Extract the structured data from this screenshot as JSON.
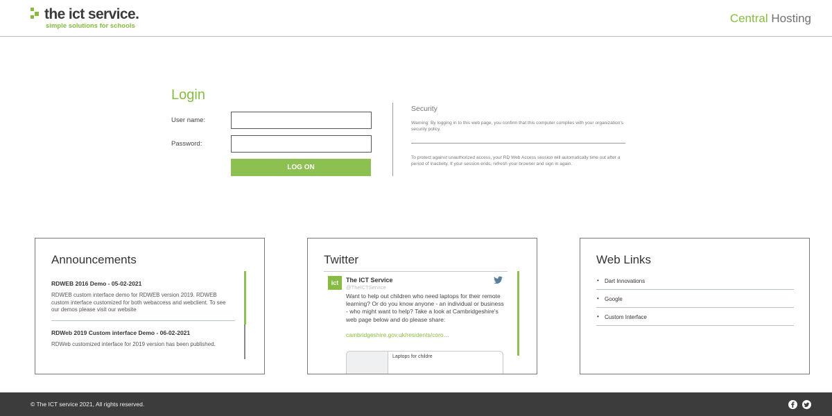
{
  "header": {
    "logo_text": "the ict service.",
    "logo_tagline": "simple solutions for schools",
    "brand_green": "Central",
    "brand_gray": "Hosting"
  },
  "login": {
    "title": "Login",
    "username_label": "User name:",
    "username_value": "",
    "password_label": "Password:",
    "password_value": "",
    "logon_button": "LOG ON"
  },
  "security": {
    "title": "Security",
    "warning": "Warning: By logging in to this web page, you confirm that this computer complies with your organization's security policy.",
    "timeout_note": "To protect against unauthorized access, your RD Web Access session will automatically time out after a period of inactivity. If your session ends, refresh your browser and sign in again."
  },
  "announcements": {
    "title": "Announcements",
    "items": [
      {
        "heading": "RDWEB 2016 Demo - 05-02-2021",
        "body": "RDWEB custom interface demo for RDWEB version 2019. RDWEB custom interface customized for both webaccess and webclient. To see our demos please visit our website"
      },
      {
        "heading": "RDWeb 2019 Custom interface Demo - 06-02-2021",
        "body": "RDWeb customized interface for 2019 version has been published."
      }
    ]
  },
  "twitter": {
    "title": "Twitter",
    "avatar_text": "ict",
    "account_name": "The ICT Service",
    "handle": "@TheICTService",
    "tweet_text": "Want to help out children who need laptops for their remote learning? Or do you know anyone - an individual or business - who might want to help? Take a look at Cambridgeshire's web page below and do please share:",
    "tweet_link": "cambridgeshire.gov.uk/residents/coro…",
    "card_text": "Laptops for childre",
    "bird_icon": "twitter-bird-icon"
  },
  "weblinks": {
    "title": "Web Links",
    "items": [
      {
        "label": "Dart Innovations"
      },
      {
        "label": "Google"
      },
      {
        "label": "Custom Interface"
      }
    ]
  },
  "footer": {
    "copyright": "© The ICT service 2021, All rights reserved.",
    "social_icons": [
      "facebook-icon",
      "twitter-icon"
    ]
  },
  "colors": {
    "accent_green": "#86bc40",
    "button_green": "#8cc152",
    "footer_bg": "#3c3c3c",
    "text_gray": "#777777"
  }
}
